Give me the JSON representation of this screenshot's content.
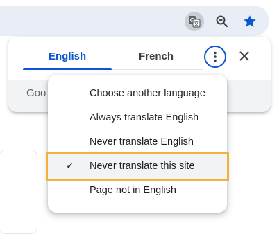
{
  "toolbar": {
    "icons": [
      "translate-icon",
      "zoom-icon",
      "bookmark-star-icon"
    ],
    "star_color": "#0b57d0"
  },
  "bubble": {
    "tabs": [
      {
        "label": "English",
        "selected": true
      },
      {
        "label": "French",
        "selected": false
      }
    ],
    "footer_text": "Goo",
    "accent": "#0b57d0"
  },
  "menu": {
    "items": [
      {
        "label": "Choose another language",
        "checked": false
      },
      {
        "label": "Always translate English",
        "checked": false
      },
      {
        "label": "Never translate English",
        "checked": false
      },
      {
        "label": "Never translate this site",
        "checked": true
      },
      {
        "label": "Page not in English",
        "checked": false
      }
    ],
    "check_glyph": "✓",
    "highlight_color": "#f0b23a"
  }
}
